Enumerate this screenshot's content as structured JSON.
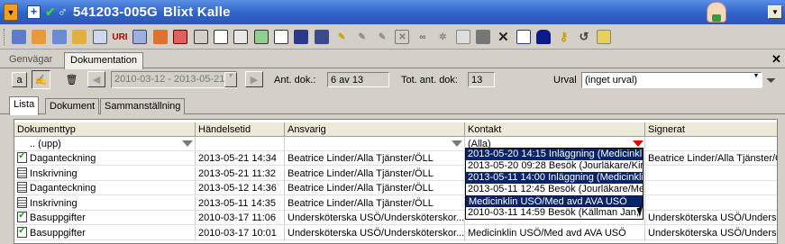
{
  "window": {
    "patient_id": "541203-005G",
    "patient_name": "Blixt Kalle",
    "pin_icon": "pin-icon",
    "expand_icon": "plus-icon",
    "status_icon": "check-icon",
    "gender_icon": "male-icon"
  },
  "navtabs": [
    {
      "label": "Genvägar"
    },
    {
      "label": "Dokumentation"
    }
  ],
  "filter": {
    "date_range": "2010-03-12 - 2013-05-21",
    "ant_dok_label": "Ant. dok.:",
    "ant_dok_value": "6 av 13",
    "tot_ant_dok_label": "Tot. ant. dok:",
    "tot_ant_dok_value": "13",
    "urval_label": "Urval",
    "urval_value": "(inget urval)"
  },
  "subtabs": [
    {
      "label": "Lista"
    },
    {
      "label": "Dokument"
    },
    {
      "label": "Sammanställning"
    }
  ],
  "grid": {
    "columns": [
      "Dokumenttyp",
      "Händelsetid",
      "Ansvarig",
      "Kontakt",
      "Signerat"
    ],
    "filter_row": {
      "dokumenttyp": ".. (upp)",
      "kontakt": "(Alla)"
    },
    "rows": [
      {
        "icon": "signed",
        "typ": "Daganteckning",
        "tid": "2013-05-21 14:34",
        "ansvarig": "Beatrice Linder/Alla Tjänster/ÖLL",
        "kontakt": "2013-05-20 14:15 Inläggning (Medicinklin",
        "signerat": "Beatrice Linder/Alla Tjänster/ÖLL"
      },
      {
        "icon": "doc",
        "typ": "Inskrivning",
        "tid": "2013-05-21 11:32",
        "ansvarig": "Beatrice Linder/Alla Tjänster/ÖLL",
        "kontakt": "",
        "signerat": ""
      },
      {
        "icon": "doc",
        "typ": "Daganteckning",
        "tid": "2013-05-12 14:36",
        "ansvarig": "Beatrice Linder/Alla Tjänster/ÖLL",
        "kontakt": "",
        "signerat": ""
      },
      {
        "icon": "doc",
        "typ": "Inskrivning",
        "tid": "2013-05-11 14:35",
        "ansvarig": "Beatrice Linder/Alla Tjänster/ÖLL",
        "kontakt": "",
        "signerat": ""
      },
      {
        "icon": "signed",
        "typ": "Basuppgifter",
        "tid": "2010-03-17 11:06",
        "ansvarig": "Undersköterska USÖ/Undersköterskor...",
        "kontakt": "",
        "signerat": "Undersköterska USÖ/Underskö"
      },
      {
        "icon": "signed",
        "typ": "Basuppgifter",
        "tid": "2010-03-17 10:01",
        "ansvarig": "Undersköterska USÖ/Undersköterskor...",
        "kontakt": "Medicinklin USÖ/Med avd AVA USÖ",
        "signerat": "Undersköterska USÖ/Underskö"
      }
    ]
  },
  "kontakt_dropdown": {
    "items": [
      {
        "label": "2013-05-20 14:15 Inläggning (Medicinklin",
        "selected": true
      },
      {
        "label": "2013-05-20 09:28 Besök (Jourläkare/Kiru",
        "selected": false
      },
      {
        "label": "2013-05-11 14:00 Inläggning (Medicinklin",
        "selected": true
      },
      {
        "label": "2013-05-11 12:45 Besök (Jourläkare/Med",
        "selected": false
      },
      {
        "label": "Medicinklin USÖ/Med avd AVA USÖ",
        "selected": true
      },
      {
        "label": "2010-03-11 14:59 Besök (Källman Jan,",
        "selected": false
      }
    ]
  },
  "colors": {
    "title_bar": "#2f63c8",
    "selection": "#0a246a",
    "filter_active": "#e00000"
  }
}
